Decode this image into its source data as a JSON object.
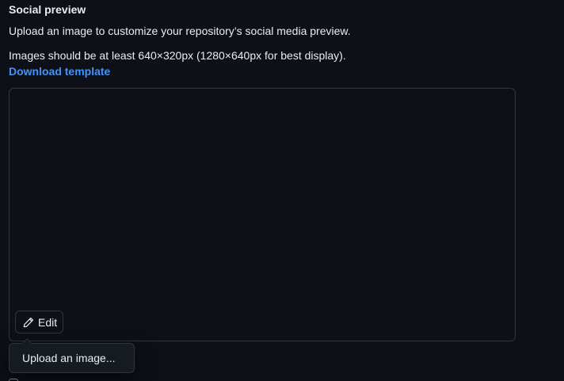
{
  "social_preview": {
    "title": "Social preview",
    "description": "Upload an image to customize your repository’s social media preview.",
    "requirements": "Images should be at least 640×320px (1280×640px for best display).",
    "download_link_label": "Download template",
    "edit_button_label": "Edit",
    "edit_icon": "pencil-icon",
    "menu": {
      "items": [
        {
          "label": "Upload an image..."
        }
      ]
    }
  },
  "colors": {
    "background": "#0d1117",
    "text": "#e6edf3",
    "link": "#4493f8",
    "border": "#30363d",
    "menu_background": "#161b22"
  }
}
